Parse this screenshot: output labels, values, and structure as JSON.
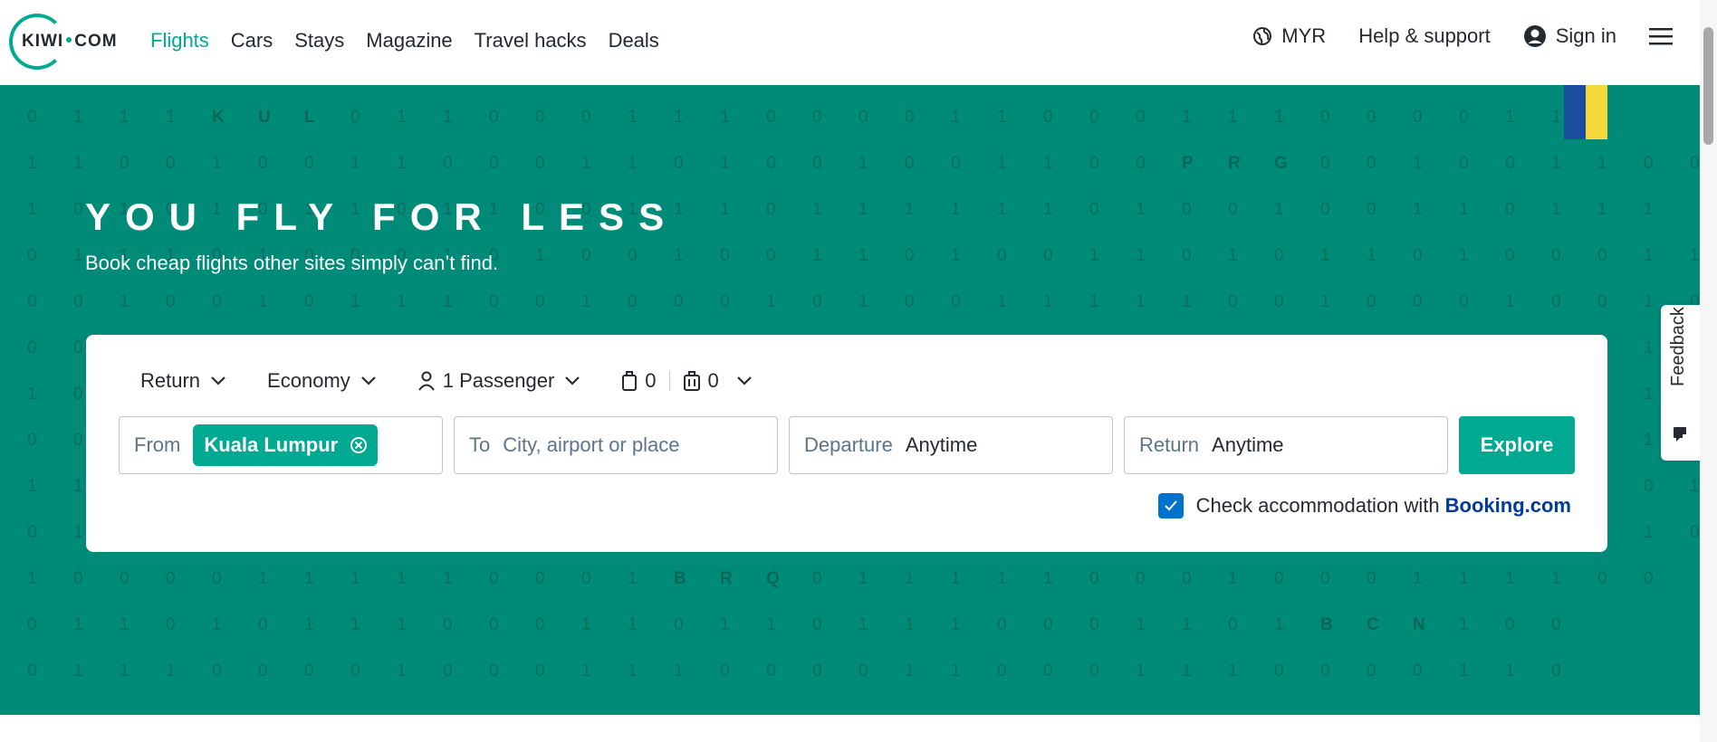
{
  "brand": {
    "logo_left": "KIWI",
    "logo_right": "COM",
    "accent": "#00a991"
  },
  "nav": {
    "items": [
      "Flights",
      "Cars",
      "Stays",
      "Magazine",
      "Travel hacks",
      "Deals"
    ],
    "active": "Flights"
  },
  "header_right": {
    "currency": "MYR",
    "help": "Help & support",
    "signin": "Sign in"
  },
  "hero": {
    "title": "YOU FLY FOR LESS",
    "subtitle": "Book cheap flights other sites simply can’t find.",
    "bg_color": "#008a78"
  },
  "search": {
    "trip_type": "Return",
    "cabin_class": "Economy",
    "passengers": "1 Passenger",
    "cabin_bags": "0",
    "checked_bags": "0",
    "from_label": "From",
    "from_value": "Kuala Lumpur",
    "to_label": "To",
    "to_placeholder": "City, airport or place",
    "departure_label": "Departure",
    "departure_value": "Anytime",
    "return_label": "Return",
    "return_value": "Anytime",
    "explore_label": "Explore",
    "accommodation_text": "Check accommodation with",
    "accommodation_brand": "Booking.com",
    "accommodation_checked": true
  },
  "feedback": {
    "label": "Feedback"
  },
  "digits_rows": [
    "0111KUL0110001110000110001110000110",
    "1100100110001101001001100PRG001001100",
    "101010110110011101111110100100110111",
    "0111010001010010011010011010110100011",
    "0010010111001000101001111100100010010ZAG0",
    "000101001001010010011100100101001001001",
    "100101001001110010010010110011010011",
    "00100110101001001011001101001001010100",
    "1100101001010100110011010010101001001101",
    "0101010101010101010101010101010101010",
    "10000111110001BRQ0111110001000111100",
    "0110101110001101101110001101BCN100",
    "0111000010001110000110001110000110"
  ]
}
